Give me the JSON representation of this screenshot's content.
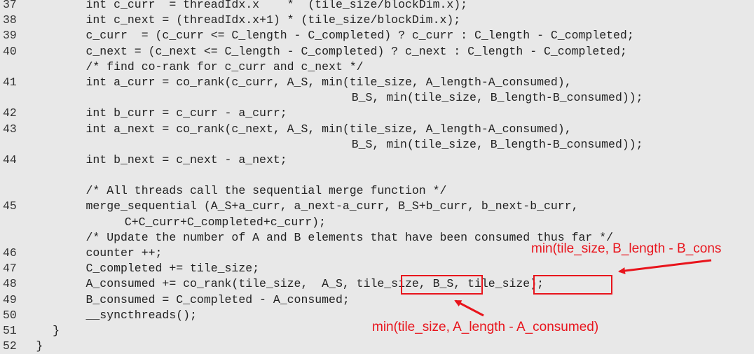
{
  "lines": [
    {
      "num": "37",
      "indent": 15,
      "text": "int c_curr  = threadIdx.x    *  (tile_size/blockDim.x);"
    },
    {
      "num": "38",
      "indent": 15,
      "text": "int c_next = (threadIdx.x+1) * (tile_size/blockDim.x);"
    },
    {
      "num": "39",
      "indent": 15,
      "text": "c_curr  = (c_curr <= C_length - C_completed) ? c_curr : C_length - C_completed;"
    },
    {
      "num": "40",
      "indent": 15,
      "text": "c_next = (c_next <= C_length - C_completed) ? c_next : C_length - C_completed;"
    },
    {
      "num": "",
      "indent": 15,
      "text": "/* find co-rank for c_curr and c_next */"
    },
    {
      "num": "41",
      "indent": 15,
      "text": "int a_curr = co_rank(c_curr, A_S, min(tile_size, A_length-A_consumed),"
    },
    {
      "num": "",
      "indent": 63,
      "text": "B_S, min(tile_size, B_length-B_consumed));"
    },
    {
      "num": "42",
      "indent": 15,
      "text": "int b_curr = c_curr - a_curr;"
    },
    {
      "num": "43",
      "indent": 15,
      "text": "int a_next = co_rank(c_next, A_S, min(tile_size, A_length-A_consumed),"
    },
    {
      "num": "",
      "indent": 63,
      "text": "B_S, min(tile_size, B_length-B_consumed));"
    },
    {
      "num": "44",
      "indent": 15,
      "text": "int b_next = c_next - a_next;"
    },
    {
      "num": "",
      "indent": 0,
      "text": ""
    },
    {
      "num": "",
      "indent": 15,
      "text": "/* All threads call the sequential merge function */"
    },
    {
      "num": "45",
      "indent": 15,
      "text": "merge_sequential (A_S+a_curr, a_next-a_curr, B_S+b_curr, b_next-b_curr,"
    },
    {
      "num": "",
      "indent": 22,
      "text": "C+C_curr+C_completed+c_curr);"
    },
    {
      "num": "",
      "indent": 15,
      "text": "/* Update the number of A and B elements that have been consumed thus far */"
    },
    {
      "num": "46",
      "indent": 15,
      "text": "counter ++;"
    },
    {
      "num": "47",
      "indent": 15,
      "text": "C_completed += tile_size;"
    },
    {
      "num": "48",
      "indent": 15,
      "text": "A_consumed += co_rank(tile_size,  A_S, tile_size, B_S, tile_size);"
    },
    {
      "num": "49",
      "indent": 15,
      "text": "B_consumed = C_completed - A_consumed;"
    },
    {
      "num": "50",
      "indent": 15,
      "text": "__syncthreads();"
    },
    {
      "num": "51",
      "indent": 9,
      "text": "}"
    },
    {
      "num": "52",
      "indent": 6,
      "text": "}"
    }
  ],
  "annotations": {
    "b_min": "min(tile_size, B_length - B_cons",
    "a_min": "min(tile_size, A_length - A_consumed)"
  },
  "colors": {
    "accent": "#e8141c",
    "background": "#e8e8e8",
    "text": "#222222"
  }
}
